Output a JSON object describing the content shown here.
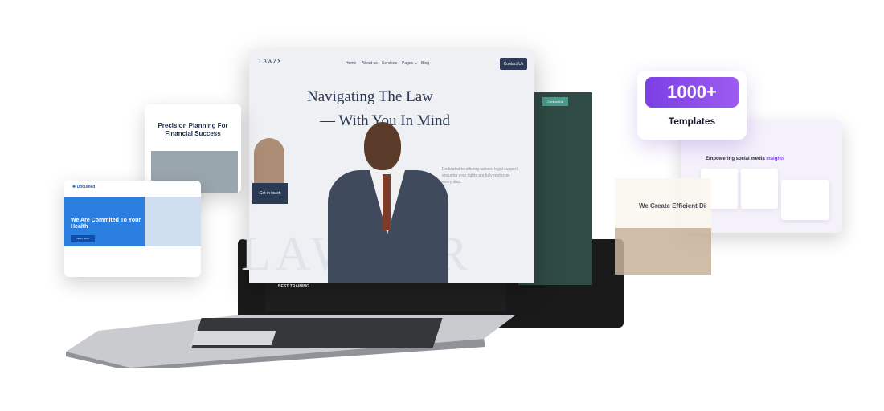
{
  "law": {
    "logo": "LAWZX",
    "nav": [
      "Home",
      "About us",
      "Services",
      "Pages ⌄",
      "Blog"
    ],
    "contact": "Contact Us",
    "headline_1": "Navigating The Law",
    "headline_2": "— With You In Mind",
    "copy": "Dedicated to offering tailored legal support, ensuring your rights are fully protected every step.",
    "get_in_touch": "Get in touch",
    "watermark": "LAWYER"
  },
  "teal": {
    "button": "Contact Us"
  },
  "dark_strip": {
    "label": "BEST TRAINING"
  },
  "finance": {
    "title": "Precision Planning For Financial Success"
  },
  "medical": {
    "logo": "✚ Documed",
    "title": "We Are Commited To Your Health",
    "button": "Learn More"
  },
  "templates": {
    "count": "1000+",
    "label": "Templates"
  },
  "social": {
    "title_prefix": "Empowering social media ",
    "title_highlight": "Insights"
  },
  "efficient": {
    "title": "We Create Efficient Di"
  },
  "colors": {
    "brand_navy": "#2b3a55",
    "purple": "#7b3fe4",
    "teal": "#4a9b8e"
  }
}
